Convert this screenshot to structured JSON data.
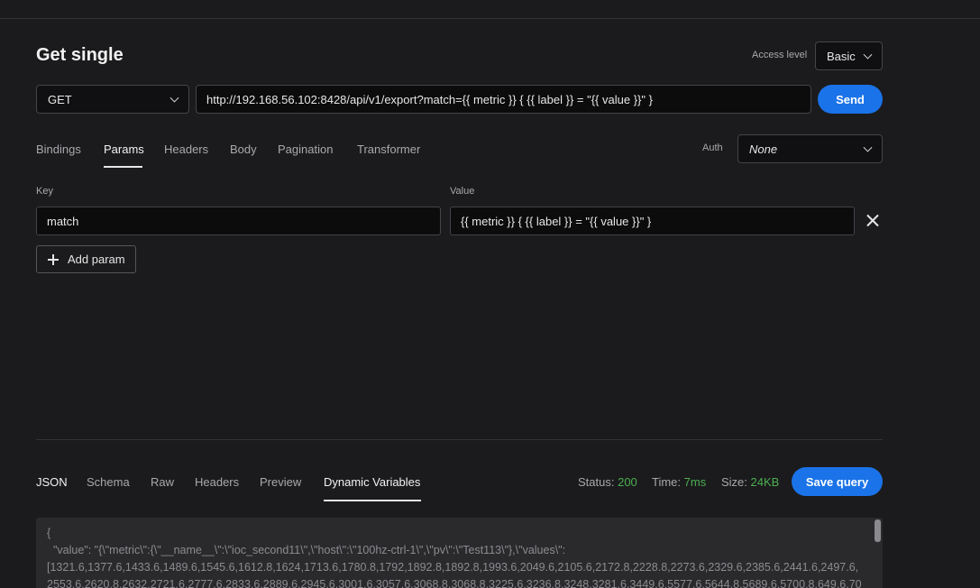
{
  "header": {
    "title": "Get single"
  },
  "access": {
    "label": "Access level",
    "value": "Basic"
  },
  "request": {
    "method": "GET",
    "url": "http://192.168.56.102:8428/api/v1/export?match={{ metric }} { {{ label }} = \"{{ value }}\" }",
    "send_label": "Send"
  },
  "tabs": [
    "Bindings",
    "Params",
    "Headers",
    "Body",
    "Pagination",
    "Transformer"
  ],
  "active_tab": "Params",
  "auth": {
    "label": "Auth",
    "value": "None"
  },
  "params": {
    "key_label": "Key",
    "value_label": "Value",
    "rows": [
      {
        "key": "match",
        "value": "{{ metric }} { {{ label }} = \"{{ value }}\" }"
      }
    ],
    "add_label": "Add param"
  },
  "response_tabs": [
    "JSON",
    "Schema",
    "Raw",
    "Headers",
    "Preview",
    "Dynamic Variables"
  ],
  "response_active_tab": "Dynamic Variables",
  "status": {
    "status_label": "Status:",
    "status_value": "200",
    "time_label": "Time:",
    "time_value": "7ms",
    "size_label": "Size:",
    "size_value": "24KB"
  },
  "save_label": "Save query",
  "response_body": {
    "line1": "{",
    "line2": "  \"value\": \"{\\\"metric\\\":{\\\"__name__\\\":\\\"ioc_second11\\\",\\\"host\\\":\\\"100hz-ctrl-1\\\",\\\"pv\\\":\\\"Test113\\\"},\\\"values\\\":",
    "line3": "[1321.6,1377.6,1433.6,1489.6,1545.6,1612.8,1624,1713.6,1780.8,1792,1892.8,1892.8,1993.6,2049.6,2105.6,2172.8,2228.8,2273.6,2329.6,2385.6,2441.6,2497.6,",
    "line4": "2553.6,2620.8,2632,2721.6,2777.6,2833.6,2889.6,2945.6,3001.6,3057.6,3068.8,3068.8,3225.6,3236.8,3248,3281.6,3449.6,5577.6,5644.8,5689.6,5700.8,649.6,70"
  },
  "colors": {
    "accent": "#1a73e8",
    "ok": "#4caf50",
    "background": "#1b1b1d"
  }
}
